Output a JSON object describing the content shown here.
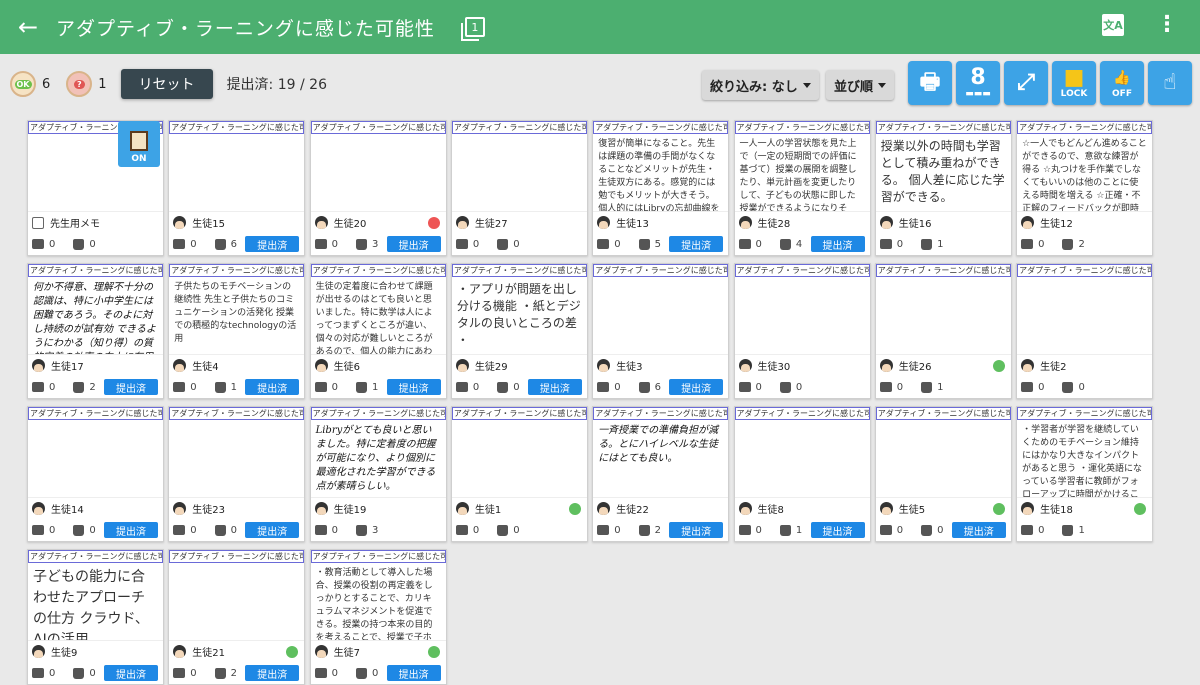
{
  "header": {
    "title": "アダプティブ・ラーニングに感じた可能性"
  },
  "toolbar": {
    "ok_count": "6",
    "q_count": "1",
    "ok_badge": "OK",
    "q_badge": "?",
    "reset_label": "リセット",
    "submitted": "提出済: 19 / 26",
    "filter_label": "絞り込み: なし",
    "sort_label": "並び順",
    "count_value": "8",
    "lock_label": "LOCK",
    "off_label": "OFF"
  },
  "card_header": "アダプティブ・ラーニングに感じた可能性",
  "submit_label": "提出済",
  "memo_on": "ON",
  "cards": [
    {
      "name": "先生用メモ",
      "comments": "0",
      "likes": "0",
      "text": "",
      "submitted": false,
      "memo": true
    },
    {
      "name": "生徒15",
      "comments": "0",
      "likes": "6",
      "text": "",
      "submitted": true
    },
    {
      "name": "生徒20",
      "comments": "0",
      "likes": "3",
      "text": "",
      "submitted": true,
      "face": "frown"
    },
    {
      "name": "生徒27",
      "comments": "0",
      "likes": "0",
      "text": "",
      "submitted": false
    },
    {
      "name": "生徒13",
      "comments": "0",
      "likes": "5",
      "text": "復習が簡単になること。先生は課題の準備の手間がなくなることなどメリットが先生・生徒双方にある。感覚的には勉でもメリットが大きそう。個人的にはLibryの忘却曲線を用いた復習レコメンドがぐっときた。",
      "submitted": true
    },
    {
      "name": "生徒28",
      "comments": "0",
      "likes": "4",
      "text": "一人一人の学習状態を見た上で（一定の短期間での評価に基づて）授業の展開を調整したり、単元計画を変更したりして、子どもの状態に即した授業ができるようになりそう。＊思いつきで変更するのではなくて。＊教師の力量形成と両輪で。",
      "submitted": true
    },
    {
      "name": "生徒16",
      "comments": "0",
      "likes": "1",
      "text": "授業以外の時間も学習として積み重ねができる。 個人差に応じた学習ができる。",
      "submitted": false,
      "style": "large"
    },
    {
      "name": "生徒12",
      "comments": "0",
      "likes": "2",
      "text": "☆一人でもどんどん進めることができるので、意欲な練習が得る ☆丸つけを手作業でしなくてもいいのは他のことに使える時間を増える ☆正確・不正解のフィードバックが即時なので、子どもたちの意欲につながる ☆小学生は難しく取り組むます",
      "submitted": false
    },
    {
      "name": "生徒17",
      "comments": "0",
      "likes": "2",
      "text": "何か不得意、理解不十分の認識は、特に小中学生には困難であろう。そのよに対し持続のが試有効 できるようにわかる（知り得）の質的定着の効率の向上に有用",
      "submitted": true,
      "style": "hw"
    },
    {
      "name": "生徒4",
      "comments": "0",
      "likes": "1",
      "text": "子供たちのモチベーションの継続性 先生と子供たちのコミュニケーションの活発化 授業での積極的なtechnologyの活用",
      "submitted": true
    },
    {
      "name": "生徒6",
      "comments": "0",
      "likes": "1",
      "text": "生徒の定着度に合わせて課題が出せるのはとても良いと思いました。特に数学は人によってつまずくところが違い、個々の対応が難しいところがあるので、個人の能力にあわせて活用してみたい。",
      "submitted": true
    },
    {
      "name": "生徒29",
      "comments": "0",
      "likes": "0",
      "text": "・アプリが問題を出し分ける機能 ・紙とデジタルの良いところの差 ・",
      "submitted": true,
      "style": "large"
    },
    {
      "name": "生徒3",
      "comments": "0",
      "likes": "6",
      "text": "",
      "submitted": true,
      "style": "tiny"
    },
    {
      "name": "生徒30",
      "comments": "0",
      "likes": "0",
      "text": "",
      "submitted": false
    },
    {
      "name": "生徒26",
      "comments": "0",
      "likes": "1",
      "text": "",
      "submitted": false,
      "face": "smile"
    },
    {
      "name": "生徒2",
      "comments": "0",
      "likes": "0",
      "text": "",
      "submitted": false
    },
    {
      "name": "生徒14",
      "comments": "0",
      "likes": "0",
      "text": "",
      "submitted": true,
      "style": "tiny"
    },
    {
      "name": "生徒23",
      "comments": "0",
      "likes": "0",
      "text": "",
      "submitted": true,
      "style": "tiny"
    },
    {
      "name": "生徒19",
      "comments": "0",
      "likes": "3",
      "text": "Libryがとても良いと思いました。特に定着度の把握が可能になり、より個別に最適化された学習ができる点が素晴らしい。",
      "submitted": false,
      "style": "hw"
    },
    {
      "name": "生徒1",
      "comments": "0",
      "likes": "0",
      "text": "",
      "submitted": false,
      "face": "smile",
      "style": "tiny"
    },
    {
      "name": "生徒22",
      "comments": "0",
      "likes": "2",
      "text": "一斉授業での準備負担が減る。とにハイレベルな生徒にはとても良い。",
      "submitted": true,
      "style": "hw"
    },
    {
      "name": "生徒8",
      "comments": "0",
      "likes": "1",
      "text": "",
      "submitted": true,
      "style": "tiny"
    },
    {
      "name": "生徒5",
      "comments": "0",
      "likes": "0",
      "text": "",
      "submitted": true,
      "face": "smile",
      "style": "tiny"
    },
    {
      "name": "生徒18",
      "comments": "0",
      "likes": "1",
      "text": "・学習者が学習を継続していくためのモチベーション維持にはかなり大きなインパクトがあると思う ・運化英語になっている学習者に教師がフォローアップに時間がかけることができることも良い",
      "submitted": false,
      "face": "smile"
    },
    {
      "name": "生徒9",
      "comments": "0",
      "likes": "0",
      "text": "子どもの能力に合わせたアプローチの仕方 クラウド、AIの活用",
      "submitted": true,
      "style": "xl"
    },
    {
      "name": "生徒21",
      "comments": "0",
      "likes": "2",
      "text": "",
      "submitted": true,
      "face": "smile",
      "style": "tiny"
    },
    {
      "name": "生徒7",
      "comments": "0",
      "likes": "0",
      "text": "・教育活動として導入した場合、授業の役割の再定義をしっかりとすることで、カリキュラムマネジメントを促進できる。授業の持つ本来の目的を考えることで、授業で子ホことと各個の能力にあわせて演習することを切り分けることができる。",
      "submitted": true,
      "face": "smile"
    }
  ]
}
